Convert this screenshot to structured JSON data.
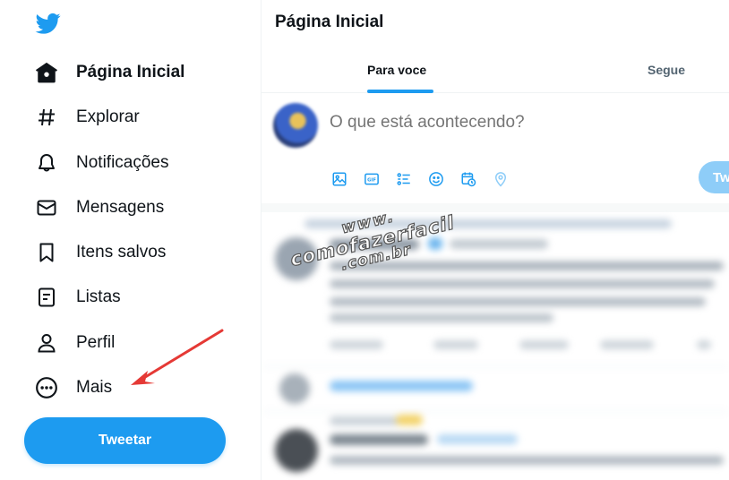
{
  "sidebar": {
    "items": [
      {
        "label": "Página Inicial",
        "icon": "home-icon",
        "active": true
      },
      {
        "label": "Explorar",
        "icon": "hashtag-icon"
      },
      {
        "label": "Notificações",
        "icon": "bell-icon"
      },
      {
        "label": "Mensagens",
        "icon": "mail-icon"
      },
      {
        "label": "Itens salvos",
        "icon": "bookmark-icon"
      },
      {
        "label": "Listas",
        "icon": "list-icon"
      },
      {
        "label": "Perfil",
        "icon": "person-icon"
      },
      {
        "label": "Mais",
        "icon": "more-circle-icon"
      }
    ],
    "tweet_button": "Tweetar"
  },
  "main": {
    "title": "Página Inicial",
    "tabs": [
      {
        "label": "Para voce",
        "active": true
      },
      {
        "label": "Segue"
      }
    ],
    "composer": {
      "placeholder": "O que está acontecendo?",
      "tools": [
        "image-icon",
        "gif-icon",
        "poll-icon",
        "emoji-icon",
        "schedule-icon",
        "location-icon"
      ],
      "tweet_button": "Tw"
    }
  },
  "watermark": {
    "line1": "www.",
    "line2": "comofazerfacil",
    "line3": ".com.br"
  },
  "colors": {
    "accent": "#1d9bf0",
    "arrow": "#e53935",
    "text": "#0f1419",
    "muted": "#536471"
  }
}
